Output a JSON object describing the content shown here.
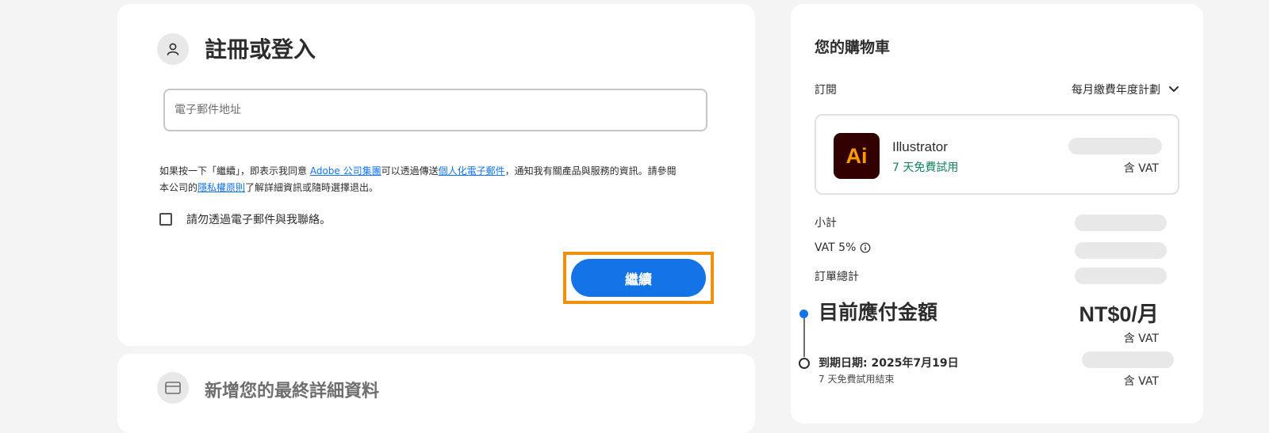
{
  "signin": {
    "title": "註冊或登入",
    "email_placeholder": "電子郵件地址",
    "consent": {
      "part1": "如果按一下「繼續」，即表示我同意 ",
      "link_adobe": "Adobe 公司集團",
      "part2": "可以透過傳送",
      "link_personalized": "個人化電子郵件",
      "part3": "，通知我有關產品與服務的資訊。請參閱本公司的",
      "link_privacy": "隱私權原則",
      "part4": "了解詳細資訊或隨時選擇退出。"
    },
    "checkbox_label": "請勿透過電子郵件與我聯絡。",
    "continue_label": "繼續"
  },
  "details": {
    "title": "新增您的最終詳細資料"
  },
  "cart": {
    "title": "您的購物車",
    "subscription_label": "訂閱",
    "plan_value": "每月繳費年度計劃",
    "product": {
      "logo_text": "Ai",
      "name": "Illustrator",
      "trial": "7 天免費試用",
      "vat_note": "含 VAT"
    },
    "subtotal_label": "小計",
    "vat_label": "VAT 5%",
    "order_total_label": "訂單總計",
    "due_now_label": "目前應付金額",
    "due_now_amount": "NT$0/月",
    "due_now_vat": "含 VAT",
    "expiry_label": "到期日期: 2025年7月19日",
    "expiry_sub": "7 天免費試用結束",
    "expiry_vat": "含 VAT"
  },
  "colors": {
    "accent": "#1473e6",
    "highlight": "#f0900c",
    "trial_green": "#12805c",
    "ai_bg": "#330000",
    "ai_fg": "#ff9a00"
  }
}
